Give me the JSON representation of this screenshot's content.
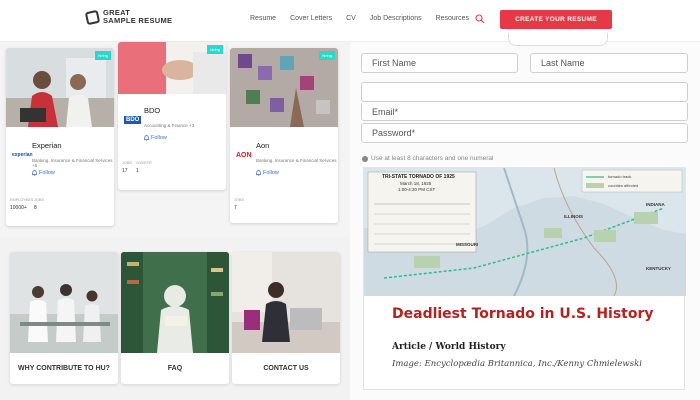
{
  "header": {
    "logo_line1": "GREAT",
    "logo_line2": "SAMPLE RESUME",
    "nav": [
      "Resume",
      "Cover Letters",
      "CV",
      "Job Descriptions",
      "Resources"
    ],
    "cta_label": "CREATE YOUR RESUME",
    "accent": "#e63946"
  },
  "companies": [
    {
      "name": "Experian",
      "logo": "experian",
      "sub": "Banking, Insurance & Financial Services +6",
      "badge": "hiring",
      "follow": "Follow",
      "stats": [
        {
          "label": "EMPLOYEES",
          "value": "10000+"
        },
        {
          "label": "JOBS",
          "value": "8"
        }
      ]
    },
    {
      "name": "BDO",
      "logo": "BDO",
      "sub": "Accounting & Finance +3",
      "badge": "hiring",
      "follow": "Follow",
      "stats": [
        {
          "label": "JOBS",
          "value": "17"
        },
        {
          "label": "OVERTR",
          "value": "1"
        }
      ]
    },
    {
      "name": "Aon",
      "logo": "AON",
      "sub": "Banking, Insurance & Financial Services",
      "badge": "hiring",
      "follow": "Follow",
      "stats": [
        {
          "label": "JOBS",
          "value": "7"
        }
      ]
    }
  ],
  "tiles": [
    {
      "label": "WHY CONTRIBUTE TO HU?"
    },
    {
      "label": "FAQ"
    },
    {
      "label": "CONTACT US"
    }
  ],
  "form": {
    "first_name_placeholder": "First Name",
    "last_name_placeholder": "Last Name",
    "email_placeholder": "Email*",
    "password_placeholder": "Password*",
    "password_hint": "Use at least 8 characters and one numeral"
  },
  "article": {
    "map_title": "TRI-STATE TORNADO OF 1925",
    "map_subtitle": "March 18, 1925",
    "map_time": "1:00-4:30 PM CST",
    "map_legend": [
      "tornado track",
      "counties affected"
    ],
    "map_states": [
      "MISSOURI",
      "ILLINOIS",
      "INDIANA",
      "KENTUCKY"
    ],
    "title": "Deadliest Tornado in U.S. History",
    "category": "Article / World History",
    "credit": "Image: Encyclopædia Britannica, Inc./Kenny Chmielewski"
  }
}
